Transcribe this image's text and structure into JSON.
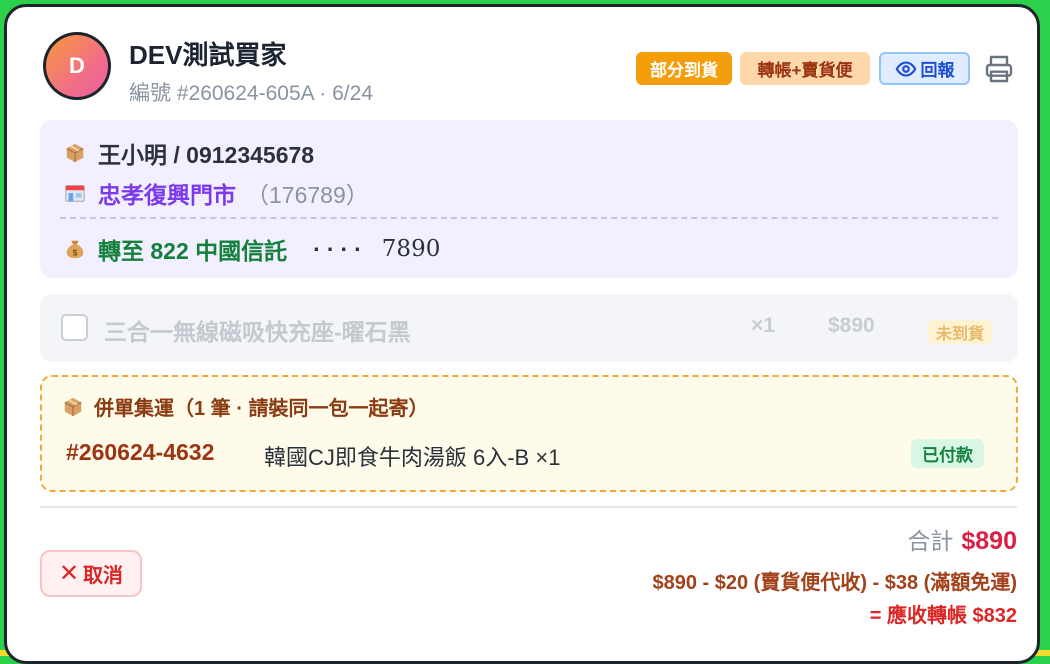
{
  "buyer": {
    "avatar_letter": "D",
    "name": "DEV測試買家",
    "order_meta": "編號 #260624-605A · 6/24"
  },
  "badges": {
    "partial": "部分到貨",
    "payment": "轉帳+賣貨便",
    "report": "回報"
  },
  "recipient": {
    "contact": "王小明 / 0912345678",
    "store_name": "忠孝復興門市",
    "store_code": "（176789）",
    "transfer_to": "轉至 822 中國信託",
    "account_mask": "····",
    "account_tail": "7890"
  },
  "item": {
    "name": "三合一無線磁吸快充座-曜石黑",
    "qty": "×1",
    "price": "$890",
    "status": "未到貨"
  },
  "merge": {
    "title": "併單集運（1 筆 · 請裝同一包一起寄）",
    "order_no": "#260624-4632",
    "order_desc": "韓國CJ即食牛肉湯飯 6入-B ×1",
    "status": "已付款"
  },
  "summary": {
    "total_label": "合計",
    "total_amount": "$890",
    "formula": "$890 - $20 (賣貨便代收) - $38 (滿額免運)",
    "receivable": "= 應收轉帳 $832"
  },
  "actions": {
    "cancel_label": "取消"
  },
  "icons": {
    "report": "eye-icon",
    "print": "printer-icon",
    "recipient": "package-icon",
    "store": "store-icon",
    "transfer": "money-bag-icon",
    "merge": "package-icon",
    "cancel": "close-icon"
  },
  "colors": {
    "accent_green": "#2bd14a",
    "badge_partial": "#f59e0b",
    "badge_payment_bg": "#fed7aa",
    "badge_report_bg": "#e0ecff",
    "store_purple": "#7c3aed",
    "transfer_green": "#15803d",
    "total_red": "#dc2045",
    "cancel_red": "#dc2626"
  }
}
